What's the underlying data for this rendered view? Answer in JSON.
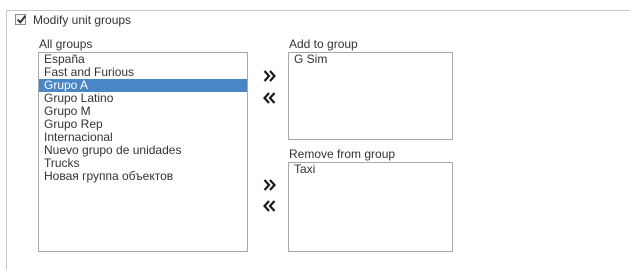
{
  "modify": {
    "label": "Modify unit groups",
    "checked": true
  },
  "all_groups": {
    "label": "All groups",
    "items": [
      "España",
      "Fast and Furious",
      "Grupo A",
      "Grupo Latino",
      "Grupo M",
      "Grupo Rep",
      "Internacional",
      "Nuevo grupo de unidades",
      "Trucks",
      "Новая группа объектов"
    ],
    "selected": "Grupo A"
  },
  "add_to_group": {
    "label": "Add to group",
    "items": [
      "G Sim"
    ]
  },
  "remove_from_group": {
    "label": "Remove from group",
    "items": [
      "Taxi"
    ]
  },
  "icons": {
    "checkmark": "checkmark-icon",
    "move_right": "double-chevron-right-icon",
    "move_left": "double-chevron-left-icon"
  },
  "colors": {
    "selection": "#4a86c5",
    "border": "#a8a8a8"
  }
}
